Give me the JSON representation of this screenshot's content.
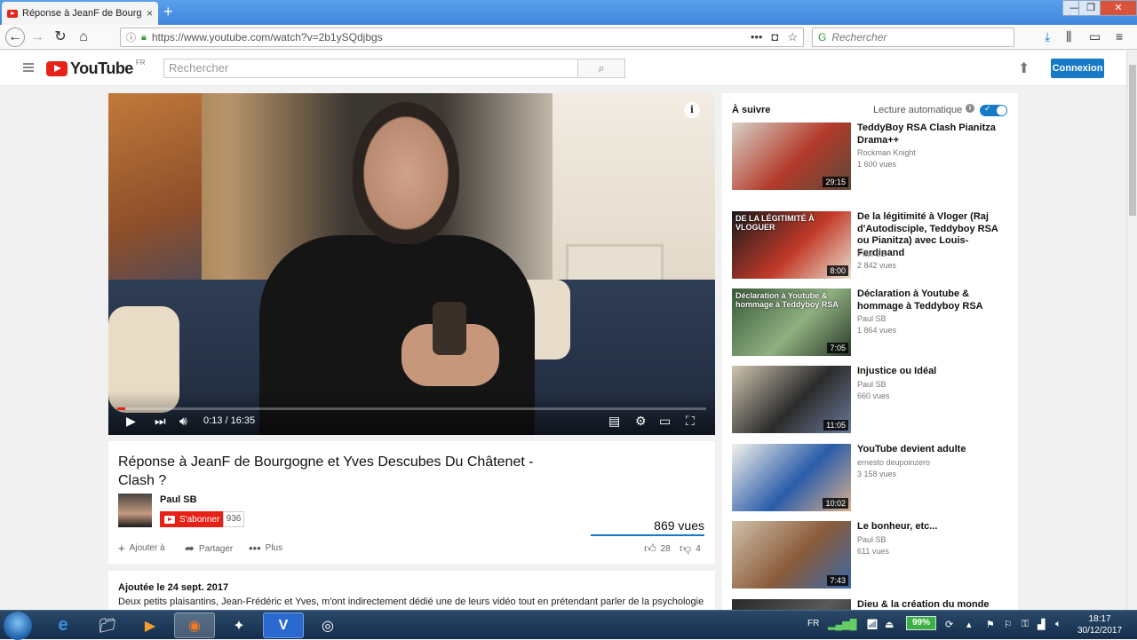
{
  "browser": {
    "tab_title": "Réponse à JeanF de Bourgogne",
    "tab_close": "×",
    "new_tab": "+",
    "url": "https://www.youtube.com/watch?v=2b1ySQdjbgs",
    "search_placeholder": "Rechercher",
    "window_controls": [
      "—",
      "❐",
      "✕"
    ]
  },
  "youtube_header": {
    "logo_text": "YouTube",
    "logo_country": "FR",
    "search_placeholder": "Rechercher",
    "signin_label": "Connexion"
  },
  "player": {
    "time_display": "0:13 / 16:35",
    "progress_fraction": 0.013,
    "info_label": "i"
  },
  "video": {
    "title": "Réponse à JeanF de Bourgogne et Yves Descubes Du Châtenet - Clash ?",
    "channel": "Paul SB",
    "subscribe_label": "S'abonner",
    "subscriber_count": "936",
    "views": "869 vues",
    "actions": {
      "add_to": "Ajouter à",
      "share": "Partager",
      "more": "Plus",
      "likes": "28",
      "dislikes": "4"
    },
    "published": "Ajoutée le 24 sept. 2017",
    "description": "Deux petits plaisantins, Jean-Frédéric et Yves, m'ont indirectement dédié une de leurs vidéo tout en prétendant parler de la psychologie des personnes de gauches. Je me suis donc permis de leur répondre. Et malheureusement je leur mets misère :-) :-)"
  },
  "sidebar": {
    "up_next": "À suivre",
    "autoplay": "Lecture automatique",
    "autoplay_info": "i",
    "videos": [
      {
        "title": "TeddyBoy RSA Clash Pianitza Drama++",
        "author": "Rockman Knight",
        "views": "1 600 vues",
        "duration": "29:15",
        "thumb_colors": [
          "#d8d2c8",
          "#b33a2a",
          "#5b4a3a"
        ]
      },
      {
        "title": "De la légitimité à Vloger (Raj d'Autodisciple, Teddyboy RSA ou Pianitza) avec Louis-Ferdinand",
        "author": "Paul SB",
        "views": "2 842 vues",
        "duration": "8:00",
        "thumb_text": "DE LA LÉGITIMITÉ À VLOGUER",
        "thumb_colors": [
          "#1a1a1a",
          "#c23a2a",
          "#e8e0d0"
        ]
      },
      {
        "title": "Déclaration à Youtube & hommage à Teddyboy RSA",
        "author": "Paul SB",
        "views": "1 864 vues",
        "duration": "7:05",
        "thumb_text": "Déclaration à Youtube & hommage à Teddyboy RSA",
        "thumb_colors": [
          "#3a5a3a",
          "#8fb080",
          "#2b3a2b"
        ]
      },
      {
        "title": "Injustice ou Idéal",
        "author": "Paul SB",
        "views": "660 vues",
        "duration": "11:05",
        "thumb_colors": [
          "#cfc5b0",
          "#2b2b2b",
          "#6a7a9a"
        ]
      },
      {
        "title": "YouTube devient adulte",
        "author": "ernesto deupoinzero",
        "views": "3 158 vues",
        "duration": "10:02",
        "thumb_colors": [
          "#f4f2ec",
          "#2a5ca8",
          "#d8b090"
        ]
      },
      {
        "title": "Le bonheur, etc...",
        "author": "Paul SB",
        "views": "611 vues",
        "duration": "7:43",
        "thumb_colors": [
          "#cfc0a8",
          "#8a5a3a",
          "#3a6aa8"
        ]
      },
      {
        "title": "Dieu & la création du monde",
        "author": "",
        "views": "",
        "duration": "",
        "thumb_colors": [
          "#2a2a2a",
          "#5a5a5a",
          "#1a1a1a"
        ]
      }
    ]
  },
  "taskbar": {
    "language": "FR",
    "battery": "99%",
    "time": "18:17",
    "date": "30/12/2017"
  }
}
